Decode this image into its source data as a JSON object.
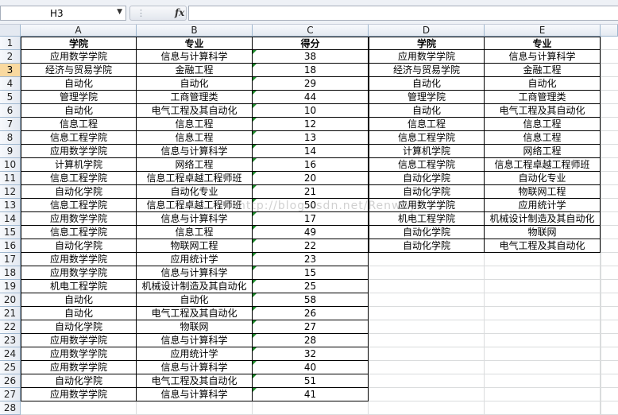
{
  "name_box": "H3",
  "fx_label": "fx",
  "formula": "",
  "columns": [
    "A",
    "B",
    "C",
    "D",
    "E"
  ],
  "rows": [
    "1",
    "2",
    "3",
    "4",
    "5",
    "6",
    "7",
    "8",
    "9",
    "10",
    "11",
    "12",
    "13",
    "14",
    "15",
    "16",
    "17",
    "18",
    "19",
    "20",
    "21",
    "22",
    "23",
    "24",
    "25",
    "26",
    "27",
    "28"
  ],
  "headers": {
    "a": "学院",
    "b": "专业",
    "c": "得分",
    "d": "学院",
    "e": "专业"
  },
  "left_table": [
    [
      "应用数学学院",
      "信息与计算科学",
      "38"
    ],
    [
      "经济与贸易学院",
      "金融工程",
      "18"
    ],
    [
      "自动化",
      "自动化",
      "29"
    ],
    [
      "管理学院",
      "工商管理类",
      "44"
    ],
    [
      "自动化",
      "电气工程及其自动化",
      "10"
    ],
    [
      "信息工程",
      "信息工程",
      "12"
    ],
    [
      "信息工程学院",
      "信息工程",
      "13"
    ],
    [
      "应用数学学院",
      "信息与计算科学",
      "14"
    ],
    [
      "计算机学院",
      "网络工程",
      "16"
    ],
    [
      "信息工程学院",
      "信息工程卓越工程师班",
      "20"
    ],
    [
      "自动化学院",
      "自动化专业",
      "21"
    ],
    [
      "信息工程学院",
      "信息工程卓越工程师班",
      "50"
    ],
    [
      "应用数学学院",
      "信息与计算科学",
      "17"
    ],
    [
      "信息工程学院",
      "信息工程",
      "49"
    ],
    [
      "自动化学院",
      "物联网工程",
      "22"
    ],
    [
      "应用数学学院",
      "应用统计学",
      "23"
    ],
    [
      "应用数学学院",
      "信息与计算科学",
      "15"
    ],
    [
      "机电工程学院",
      "机械设计制造及其自动化",
      "25"
    ],
    [
      "自动化",
      "自动化",
      "58"
    ],
    [
      "自动化",
      "电气工程及其自动化",
      "26"
    ],
    [
      "自动化学院",
      "物联网",
      "27"
    ],
    [
      "应用数学学院",
      "信息与计算科学",
      "28"
    ],
    [
      "应用数学学院",
      "应用统计学",
      "32"
    ],
    [
      "应用数学学院",
      "信息与计算科学",
      "40"
    ],
    [
      "自动化学院",
      "电气工程及其自动化",
      "51"
    ],
    [
      "应用数学学院",
      "信息与计算科学",
      "41"
    ]
  ],
  "right_table": [
    [
      "应用数学学院",
      "信息与计算科学"
    ],
    [
      "经济与贸易学院",
      "金融工程"
    ],
    [
      "自动化",
      "自动化"
    ],
    [
      "管理学院",
      "工商管理类"
    ],
    [
      "自动化",
      "电气工程及其自动化"
    ],
    [
      "信息工程",
      "信息工程"
    ],
    [
      "信息工程学院",
      "信息工程"
    ],
    [
      "计算机学院",
      "网络工程"
    ],
    [
      "信息工程学院",
      "信息工程卓越工程师班"
    ],
    [
      "自动化学院",
      "自动化专业"
    ],
    [
      "自动化学院",
      "物联网工程"
    ],
    [
      "应用数学学院",
      "应用统计学"
    ],
    [
      "机电工程学院",
      "机械设计制造及其自动化"
    ],
    [
      "自动化学院",
      "物联网"
    ],
    [
      "自动化学院",
      "电气工程及其自动化"
    ]
  ],
  "watermark": "http://blog.csdn.net/Renwoy_",
  "icons": {
    "name_box_dropdown": "chevron-down-icon",
    "fx": "function-icon"
  },
  "colors": {
    "selection_header": "#f9d99f",
    "error_indicator": "#1e8a2c",
    "header_bg": "#e4e9f1"
  }
}
